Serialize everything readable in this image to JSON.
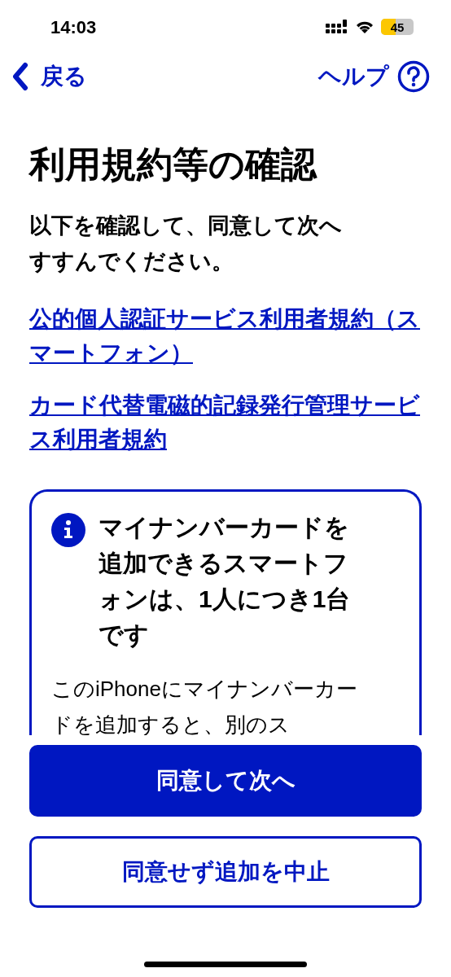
{
  "status_bar": {
    "time": "14:03",
    "battery": "45"
  },
  "nav": {
    "back": "戻る",
    "help": "ヘルプ"
  },
  "title": "利用規約等の確認",
  "intro": "以下を確認して、同意して次へすすんでください。",
  "links": [
    "公的個人認証サービス利用者規約（スマートフォン）",
    "カード代替電磁的記録発行管理サービス利用者規約"
  ],
  "notice": {
    "heading": "マイナンバーカードを追加できるスマートフォンは、1人につき1台です",
    "body": "このiPhoneにマイナンバーカードを追加すると、別のス"
  },
  "buttons": [
    {
      "label": "同意して次へ",
      "kind": "primary"
    },
    {
      "label": "同意せず追加を中止",
      "kind": "secondary"
    }
  ]
}
